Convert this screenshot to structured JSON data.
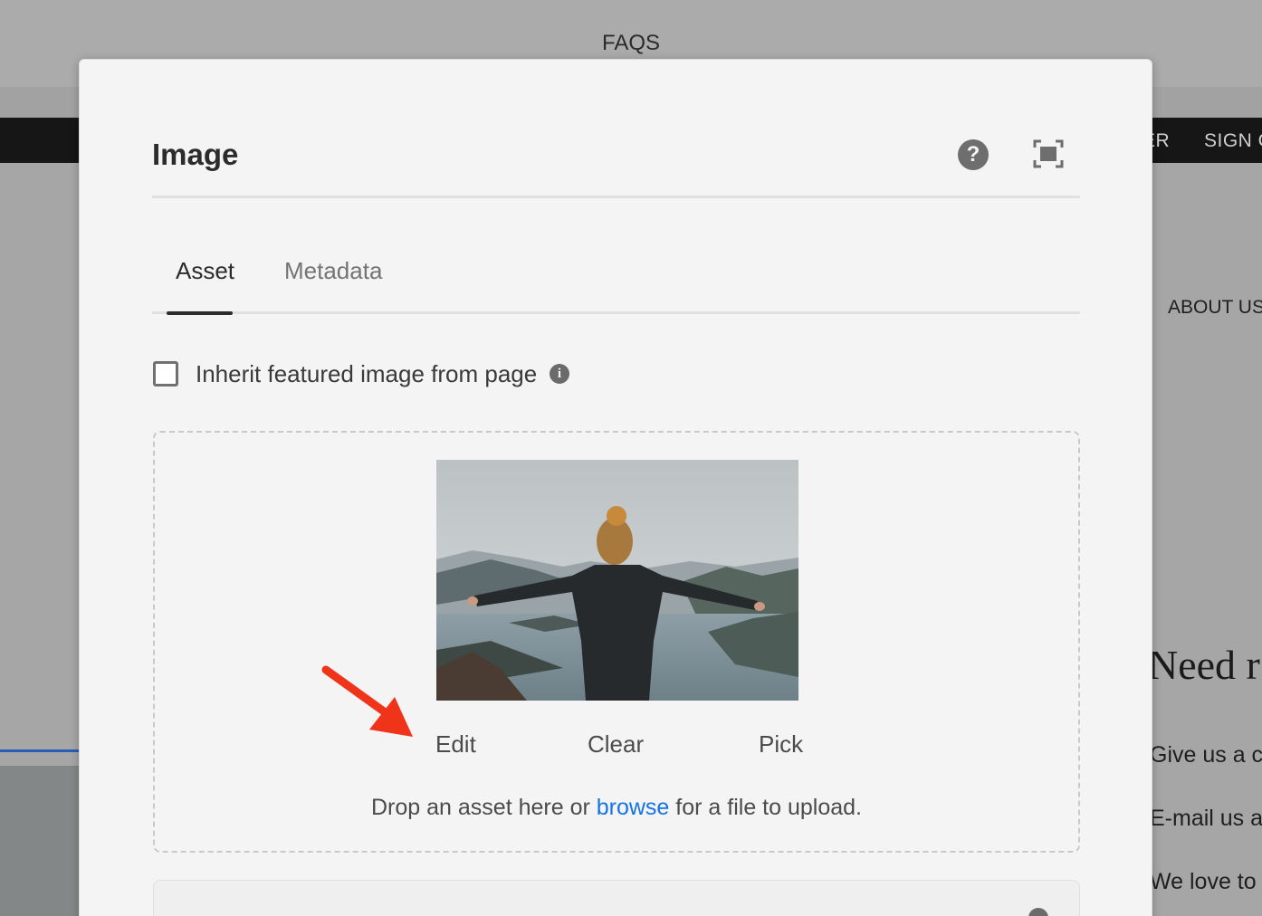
{
  "background": {
    "page_title": "FAQS",
    "nav_items": [
      "ER",
      "SIGN C"
    ],
    "section_link": "ABOUT US",
    "heading": "Need r",
    "lines": [
      "Give us a ca",
      "E-mail us at",
      "We love to t"
    ]
  },
  "dialog": {
    "title": "Image",
    "help_icon": "?",
    "fullscreen_icon": "fullscreen-icon",
    "tabs": [
      {
        "label": "Asset",
        "active": true
      },
      {
        "label": "Metadata",
        "active": false
      }
    ],
    "inherit_checkbox": {
      "label": "Inherit featured image from page",
      "checked": false,
      "info_icon": "i"
    },
    "asset": {
      "image_alt": "Person in beanie with outstretched arms overlooking a mountain lake",
      "actions": {
        "edit": "Edit",
        "clear": "Clear",
        "pick": "Pick"
      },
      "drop_text_before": "Drop an asset here or ",
      "drop_link": "browse",
      "drop_text_after": " for a file to upload."
    }
  },
  "colors": {
    "link": "#1473e6",
    "annotation_arrow": "#f0341a"
  }
}
